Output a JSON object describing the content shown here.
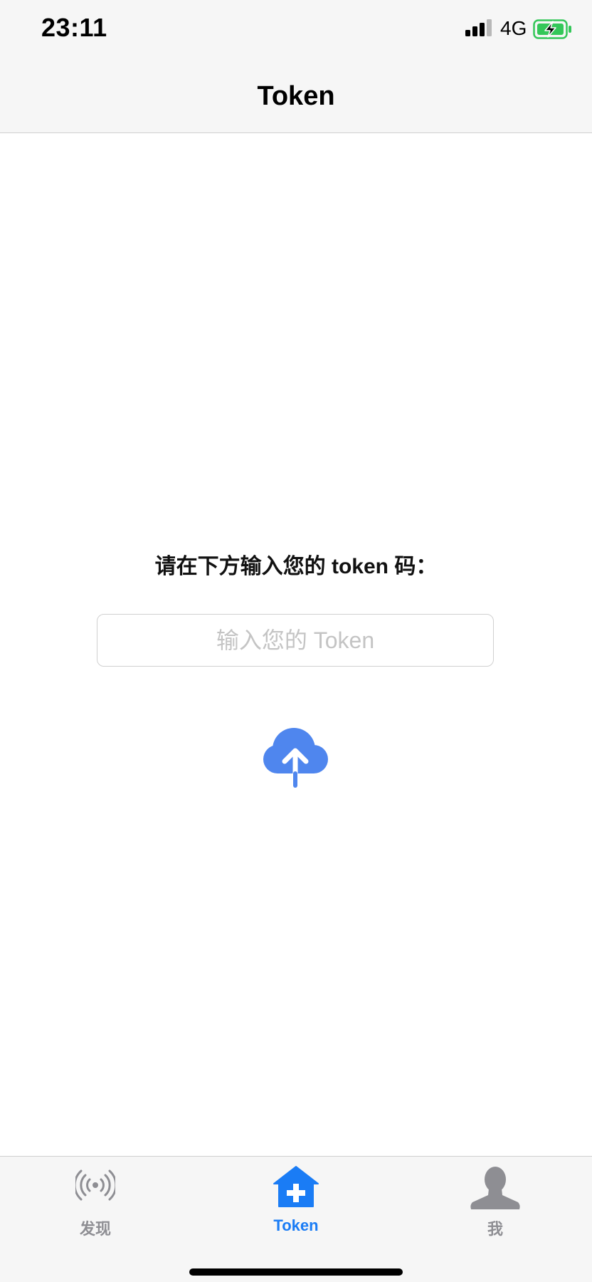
{
  "status_bar": {
    "time": "23:11",
    "network": "4G",
    "icons": [
      "signal-icon",
      "battery-charging-icon"
    ]
  },
  "nav": {
    "title": "Token"
  },
  "main": {
    "prompt": "请在下方输入您的 token 码：",
    "token_input": {
      "value": "",
      "placeholder": "输入您的 Token"
    },
    "upload_icon": "cloud-upload-icon"
  },
  "tabs": [
    {
      "label": "发现",
      "icon": "broadcast-icon",
      "active": false
    },
    {
      "label": "Token",
      "icon": "home-plus-icon",
      "active": true
    },
    {
      "label": "我",
      "icon": "user-icon",
      "active": false
    }
  ],
  "colors": {
    "accent": "#1a7cf5",
    "upload_icon": "#4f86ee",
    "inactive_tab": "#8e8e93",
    "battery": "#34c759"
  }
}
